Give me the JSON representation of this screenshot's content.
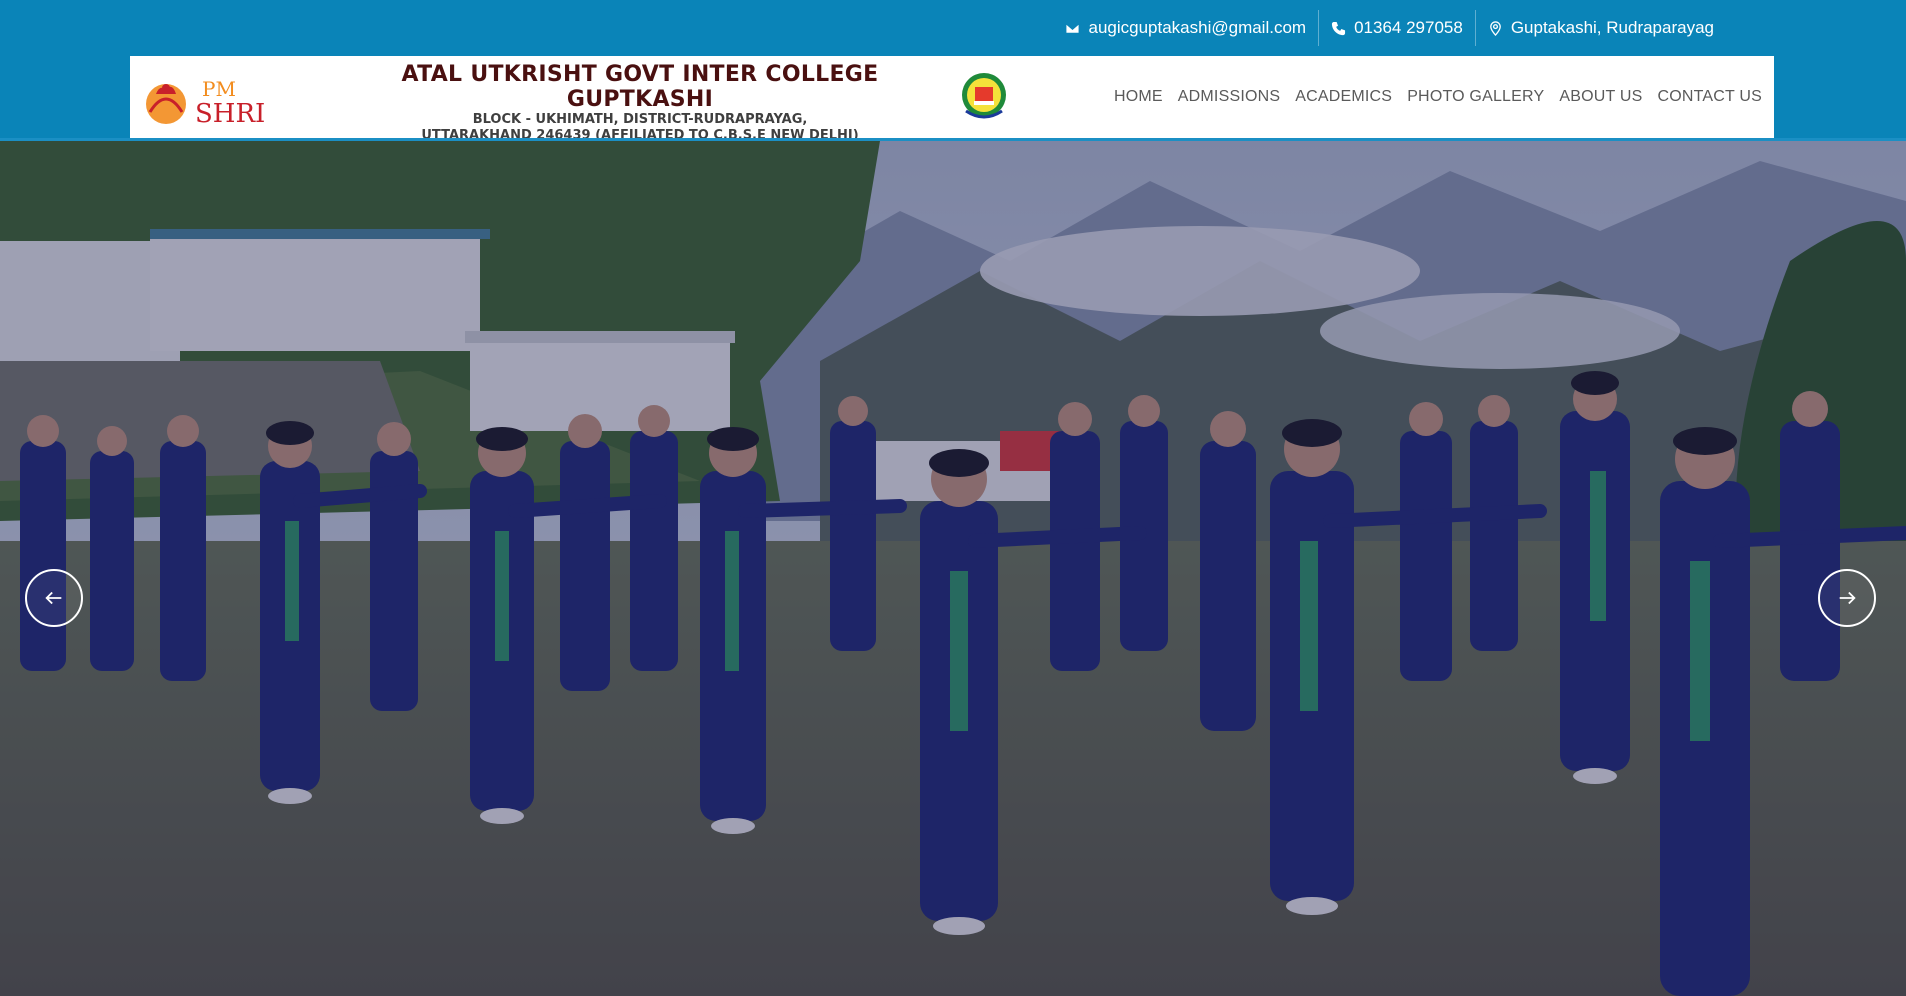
{
  "contact": {
    "email": "augicguptakashi@gmail.com",
    "phone": "01364 297058",
    "location": "Guptakashi, Rudraparayag"
  },
  "header": {
    "logo_left_text_top": "PM",
    "logo_left_text_bottom": "SHRI",
    "school_name": "ATAL UTKRISHT GOVT INTER COLLEGE GUPTKASHI",
    "address_line1": "BLOCK - UKHIMATH, DISTRICT-RUDRAPRAYAG,",
    "address_line2": "UTTARAKHAND 246439 (AFFILIATED TO C.B.S.E NEW DELHI)"
  },
  "nav": {
    "items": [
      "HOME",
      "ADMISSIONS",
      "ACADEMICS",
      "PHOTO GALLERY",
      "ABOUT US",
      "CONTACT US"
    ]
  },
  "colors": {
    "topbar": "#0a84b8",
    "school_name": "#4a1010",
    "nav_text": "#5a5a5a"
  },
  "icons": {
    "email": "envelope-icon",
    "phone": "phone-icon",
    "location": "map-pin-icon",
    "prev": "chevron-left-icon",
    "next": "chevron-right-icon"
  }
}
